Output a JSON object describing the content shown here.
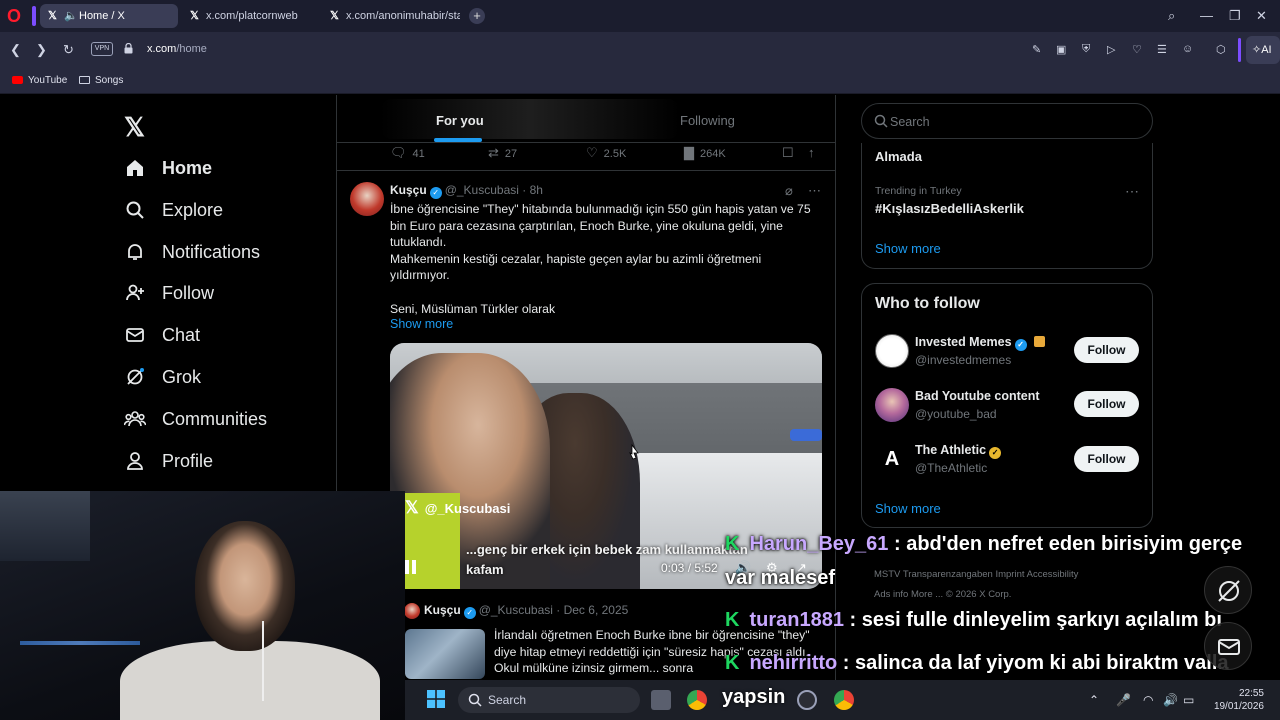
{
  "browser": {
    "tabs": [
      {
        "label": "Home / X",
        "active": true
      },
      {
        "label": "x.com/platcornweb",
        "active": false
      },
      {
        "label": "x.com/anonimuhabir/statu",
        "active": false
      }
    ],
    "url_host": "x.com",
    "url_path": "/home",
    "vpn_label": "VPN",
    "ai_label": "AI",
    "bookmarks": [
      {
        "label": "YouTube",
        "icon": "youtube-icon"
      },
      {
        "label": "Songs",
        "icon": "folder-icon"
      }
    ]
  },
  "sidebar": {
    "items": [
      {
        "label": "Home",
        "icon": "home-icon"
      },
      {
        "label": "Explore",
        "icon": "search-icon"
      },
      {
        "label": "Notifications",
        "icon": "bell-icon"
      },
      {
        "label": "Follow",
        "icon": "follow-icon"
      },
      {
        "label": "Chat",
        "icon": "mail-icon"
      },
      {
        "label": "Grok",
        "icon": "grok-icon"
      },
      {
        "label": "Communities",
        "icon": "communities-icon"
      },
      {
        "label": "Profile",
        "icon": "profile-icon"
      }
    ]
  },
  "feed": {
    "tabs": [
      "For you",
      "Following"
    ],
    "prev_actions": {
      "replies": "41",
      "reposts": "27",
      "likes": "2.5K",
      "views": "264K"
    },
    "tweet": {
      "name": "Kuşçu",
      "handle": "@_Kuscubasi",
      "time": "8h",
      "lines": [
        "İbne öğrencisine \"They\" hitabında bulunmadığı için 550 gün hapis yatan ve 75 bin Euro para cezasına çarptırılan, Enoch Burke, yine okuluna geldi, yine tutuklandı.",
        "Mahkemenin kestiği cezalar, hapiste geçen aylar bu azimli öğretmeni yıldırmıyor.",
        "",
        "Seni, Müslüman Türkler olarak"
      ],
      "show_more": "Show more",
      "video": {
        "watermark": "@_Kuscubasi",
        "caption": "...genç bir erkek için bebek zam kullanmaktan kafam",
        "time": "0:03 / 5:52"
      }
    },
    "quote": {
      "name": "Kuşçu",
      "handle": "@_Kuscubasi",
      "date": "Dec 6, 2025",
      "text": "İrlandalı öğretmen Enoch Burke ibne bir öğrencisine \"they\" diye hitap etmeyi reddettiği için \"süresiz hapis\" cezası aldı. Okul mülküne izinsiz girmem... sonra"
    }
  },
  "right": {
    "search_placeholder": "Search",
    "trend_top": "Almada",
    "trend_category": "Trending in Turkey",
    "trend_name": "#KışlasızBedelliAskerlik",
    "show_more": "Show more",
    "who_to_follow_title": "Who to follow",
    "who_to_follow": [
      {
        "name": "Invested Memes",
        "handle": "@investedmemes",
        "button": "Follow"
      },
      {
        "name": "Bad Youtube content",
        "handle": "@youtube_bad",
        "button": "Follow"
      },
      {
        "name": "The Athletic",
        "handle": "@TheAthletic",
        "button": "Follow"
      }
    ],
    "wtf_show_more": "Show more",
    "footer_row1": "MSTV Transparenzangaben   Imprint   Accessibility",
    "footer_row2": "Ads info   More ...   © 2026 X Corp."
  },
  "stream_chat": [
    {
      "user": "Harun_Bey_61",
      "message": ": abd'den nefret eden birisiyim gerçe",
      "wrap": "var malesef"
    },
    {
      "user": "turan1881",
      "message": ": sesi fulle dinleyelim şarkıyı açılalım bı"
    },
    {
      "user": "nehirritto",
      "message": ": salinca da laf yiyom ki abi biraktm valla"
    }
  ],
  "taskbar": {
    "search_placeholder": "Search",
    "overlay_text": "yapsin",
    "time": "22:55",
    "date": "19/01/2026"
  },
  "colors": {
    "accent_blue": "#1d9bf0",
    "chat_green": "#1ed760",
    "opera_red": "#ff1b2d"
  }
}
